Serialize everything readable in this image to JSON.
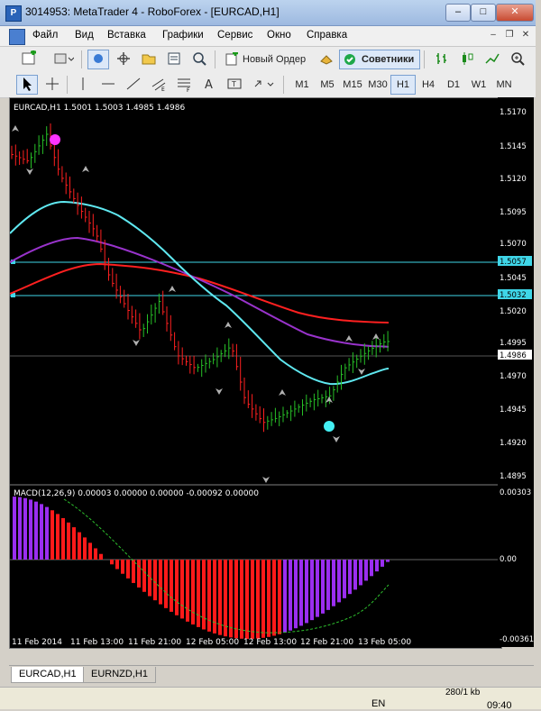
{
  "window": {
    "title": "3014953: MetaTrader 4 - RoboForex - [EURCAD,H1]",
    "icon_letter": "P"
  },
  "menu": [
    "Файл",
    "Вид",
    "Вставка",
    "Графики",
    "Сервис",
    "Окно",
    "Справка"
  ],
  "toolbar1": {
    "new_order": "Новый Ордер",
    "advisors": "Советники"
  },
  "toolbar2": {
    "timeframes": [
      "M1",
      "M5",
      "M15",
      "M30",
      "H1",
      "H4",
      "D1",
      "W1",
      "MN"
    ],
    "active_timeframe": "H1"
  },
  "chart": {
    "header": "EURCAD,H1  1.5001 1.5003 1.4985 1.4986",
    "price_labels": [
      "1.5170",
      "1.5145",
      "1.5120",
      "1.5095",
      "1.5070",
      "1.5045",
      "1.5020",
      "1.4995",
      "1.4970",
      "1.4945",
      "1.4920",
      "1.4895"
    ],
    "hline_labels": [
      "1.5057",
      "1.5032"
    ],
    "current_price": "1.4986",
    "macd_header": "MACD(12,26,9) 0.00003 0.00000 0.00000 -0.00092 0.00000",
    "macd_labels": [
      "0.00303",
      "0.00",
      "-0.00361"
    ],
    "time_labels": [
      "11 Feb 2014",
      "11 Feb 13:00",
      "11 Feb 21:00",
      "12 Feb 05:00",
      "12 Feb 13:00",
      "12 Feb 21:00",
      "13 Feb 05:00"
    ],
    "colors": {
      "bull": "#27c027",
      "bear": "#ff2020",
      "ma_fast": "#5fe8f0",
      "ma_mid": "#9933cc",
      "ma_slow": "#ff2020",
      "hline": "#3fd6e8",
      "macd_pos": "#9a2ef0",
      "macd_neg": "#ff1a1a"
    }
  },
  "tabs": [
    {
      "label": "EURCAD,H1",
      "active": true
    },
    {
      "label": "EURNZD,H1",
      "active": false
    }
  ],
  "status": {
    "lang": "EN",
    "traffic": "280/1 kb",
    "time": "09:40"
  }
}
